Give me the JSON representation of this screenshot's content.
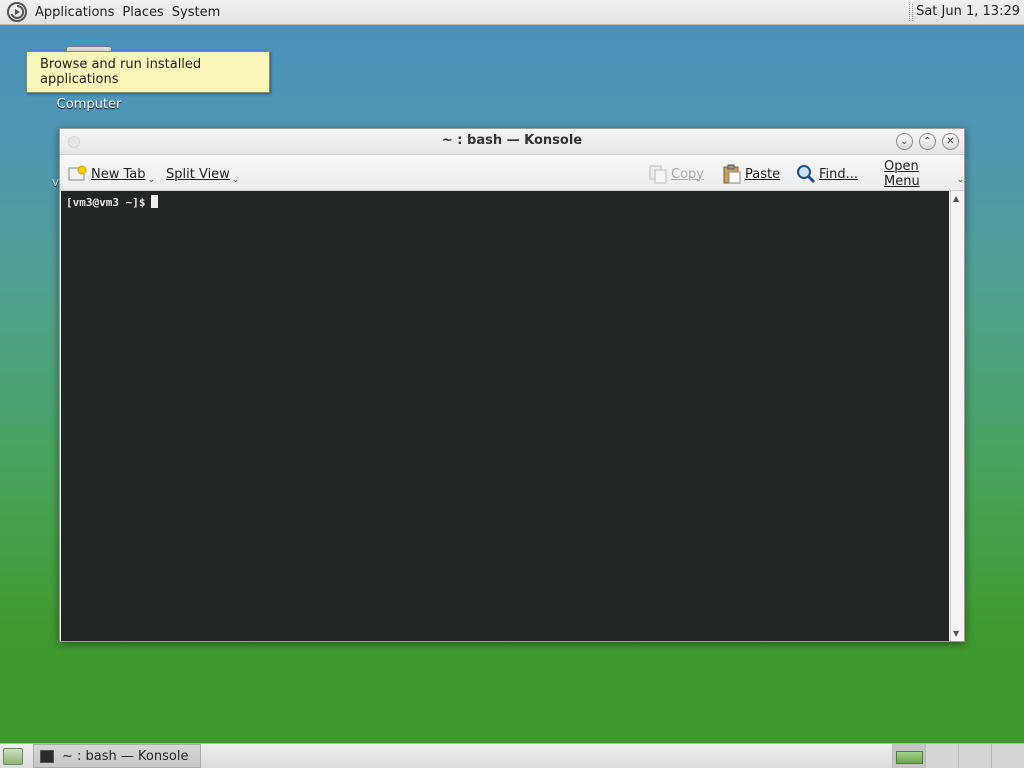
{
  "top_panel": {
    "menus": [
      "Applications",
      "Places",
      "System"
    ],
    "clock": "Sat Jun  1, 13:29"
  },
  "desktop": {
    "icons": [
      {
        "label": "Computer",
        "icon": "computer-icon"
      }
    ],
    "stray_text": "V"
  },
  "tooltip": {
    "text": "Browse and run installed applications"
  },
  "window": {
    "title": "~ : bash — Konsole",
    "toolbar": {
      "new_tab": "New Tab",
      "split_view": "Split View",
      "copy": "Copy",
      "paste": "Paste",
      "find": "Find...",
      "open_menu": "Open Menu"
    },
    "terminal": {
      "prompt": "[vm3@vm3 ~]$"
    }
  },
  "taskbar": {
    "tasks": [
      {
        "label": "~ : bash — Konsole",
        "icon": "terminal-icon"
      }
    ],
    "workspaces_count": 4,
    "active_workspace": 1
  },
  "colors": {
    "terminal_bg": "#222624",
    "tooltip_bg": "#f8f6b8",
    "panel_bg": "#e8e8e8"
  }
}
